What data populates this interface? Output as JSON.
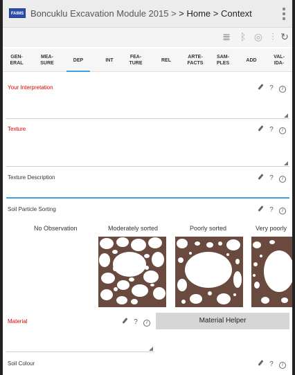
{
  "app": {
    "logo": "FAIMS",
    "breadcrumb_module": "Boncuklu Excavation Module 2015 >",
    "breadcrumb_path": " > Home > Context"
  },
  "actionbar": {
    "icons": [
      "sync-list-icon",
      "bluetooth-icon",
      "gps-icon",
      "wifi-signal-icon",
      "refresh-icon"
    ]
  },
  "tabs": [
    {
      "label": "GEN-\nERAL"
    },
    {
      "label": "MEA-\nSURE"
    },
    {
      "label": "DEP",
      "active": true
    },
    {
      "label": "INT"
    },
    {
      "label": "FEA-\nTURE"
    },
    {
      "label": "REL"
    },
    {
      "label": "ARTE-\nFACTS"
    },
    {
      "label": "SAM-\nPLES"
    },
    {
      "label": "ADD"
    },
    {
      "label": "VAL-\nIDA-"
    }
  ],
  "fields": {
    "interpretation": {
      "label": "Your Interpretation",
      "value": ""
    },
    "texture": {
      "label": "Texture",
      "value": ""
    },
    "texture_description": {
      "label": "Texture Description",
      "value": ""
    },
    "soil_particle_sorting": {
      "label": "Soil Particle Sorting",
      "options": [
        "No Observation",
        "Moderately sorted",
        "Poorly sorted",
        "Very poorly"
      ]
    },
    "material": {
      "label": "Material",
      "value": ""
    },
    "soil_colour": {
      "label": "Soil Colour"
    }
  },
  "buttons": {
    "material_helper": "Material Helper"
  },
  "field_icons": {
    "edit": "pencil-icon",
    "help": "?",
    "info": "i"
  },
  "colors": {
    "accent": "#3aa0e0",
    "required": "#e00000",
    "sort_image_fill": "#6a4a3f"
  }
}
